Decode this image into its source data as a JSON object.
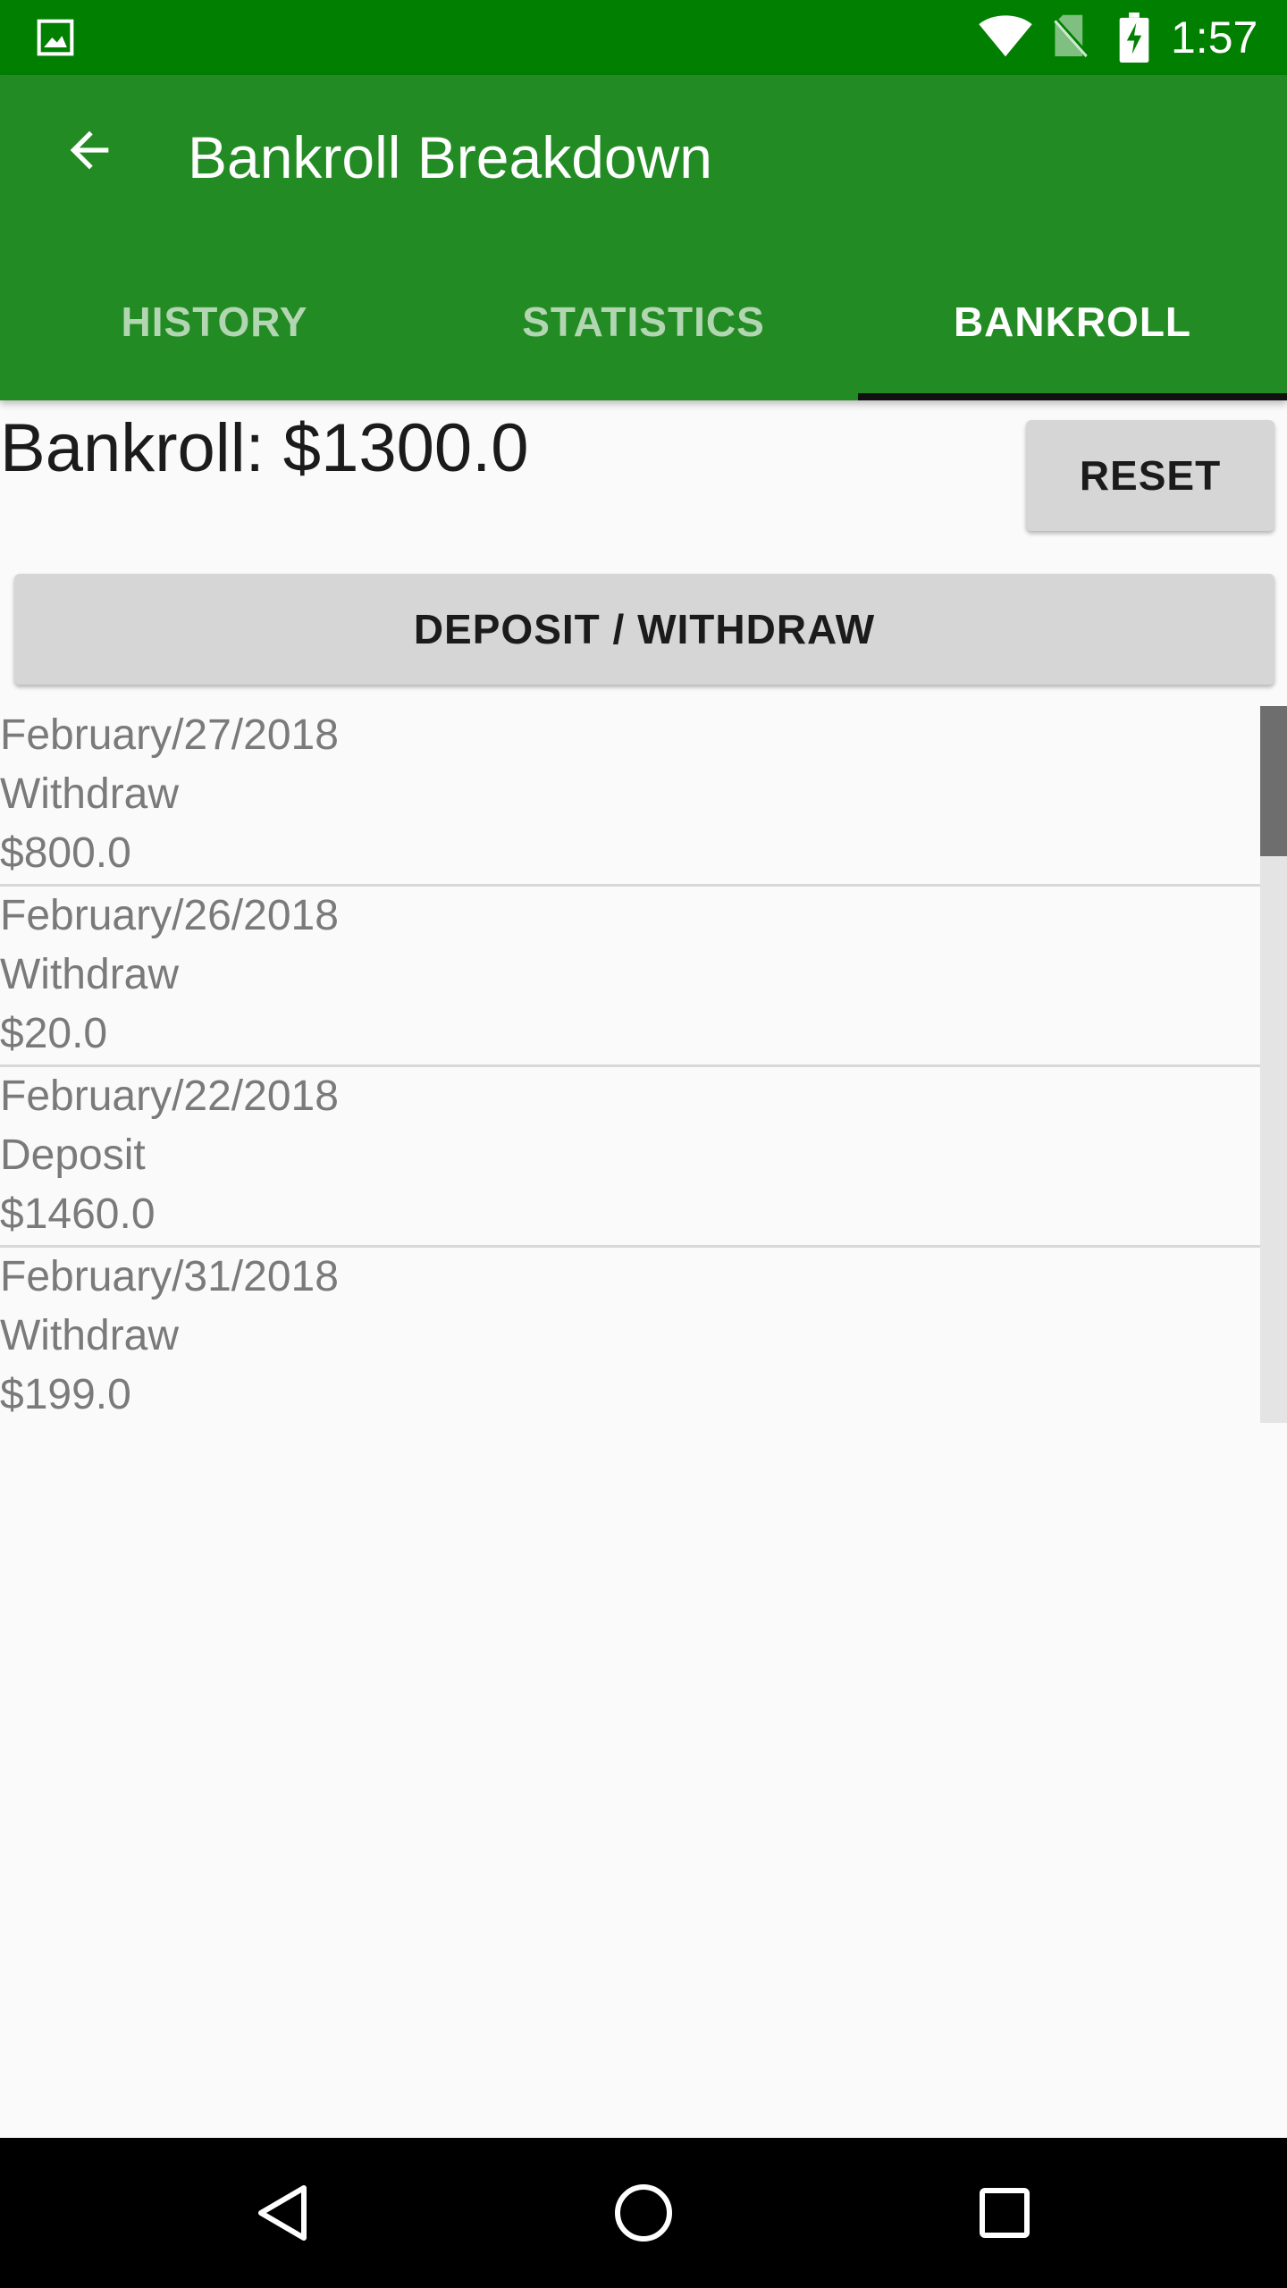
{
  "status_bar": {
    "time": "1:57",
    "icons": [
      "gallery-icon",
      "wifi-icon",
      "no-sim-icon",
      "battery-charging-icon"
    ]
  },
  "toolbar": {
    "title": "Bankroll Breakdown",
    "back_icon": "arrow-back-icon"
  },
  "tabs": [
    {
      "label": "HISTORY",
      "active": false
    },
    {
      "label": "STATISTICS",
      "active": false
    },
    {
      "label": "BANKROLL",
      "active": true
    }
  ],
  "bankroll": {
    "total_label": "Bankroll: $1300.0",
    "reset_label": "RESET",
    "deposit_withdraw_label": "DEPOSIT / WITHDRAW"
  },
  "transactions": [
    {
      "date": "February/27/2018",
      "type": "Withdraw",
      "amount": "$800.0"
    },
    {
      "date": "February/26/2018",
      "type": "Withdraw",
      "amount": "$20.0"
    },
    {
      "date": "February/22/2018",
      "type": "Deposit",
      "amount": "$1460.0"
    },
    {
      "date": "February/31/2018",
      "type": "Withdraw",
      "amount": "$199.0"
    }
  ],
  "colors": {
    "status_bar": "#017f01",
    "toolbar": "#238b23",
    "tab_indicator": "#111111",
    "button": "#d6d6d6",
    "list_text": "#7a7a7a"
  },
  "nav_bar": {
    "icons": [
      "nav-back-icon",
      "nav-home-icon",
      "nav-recents-icon"
    ]
  }
}
